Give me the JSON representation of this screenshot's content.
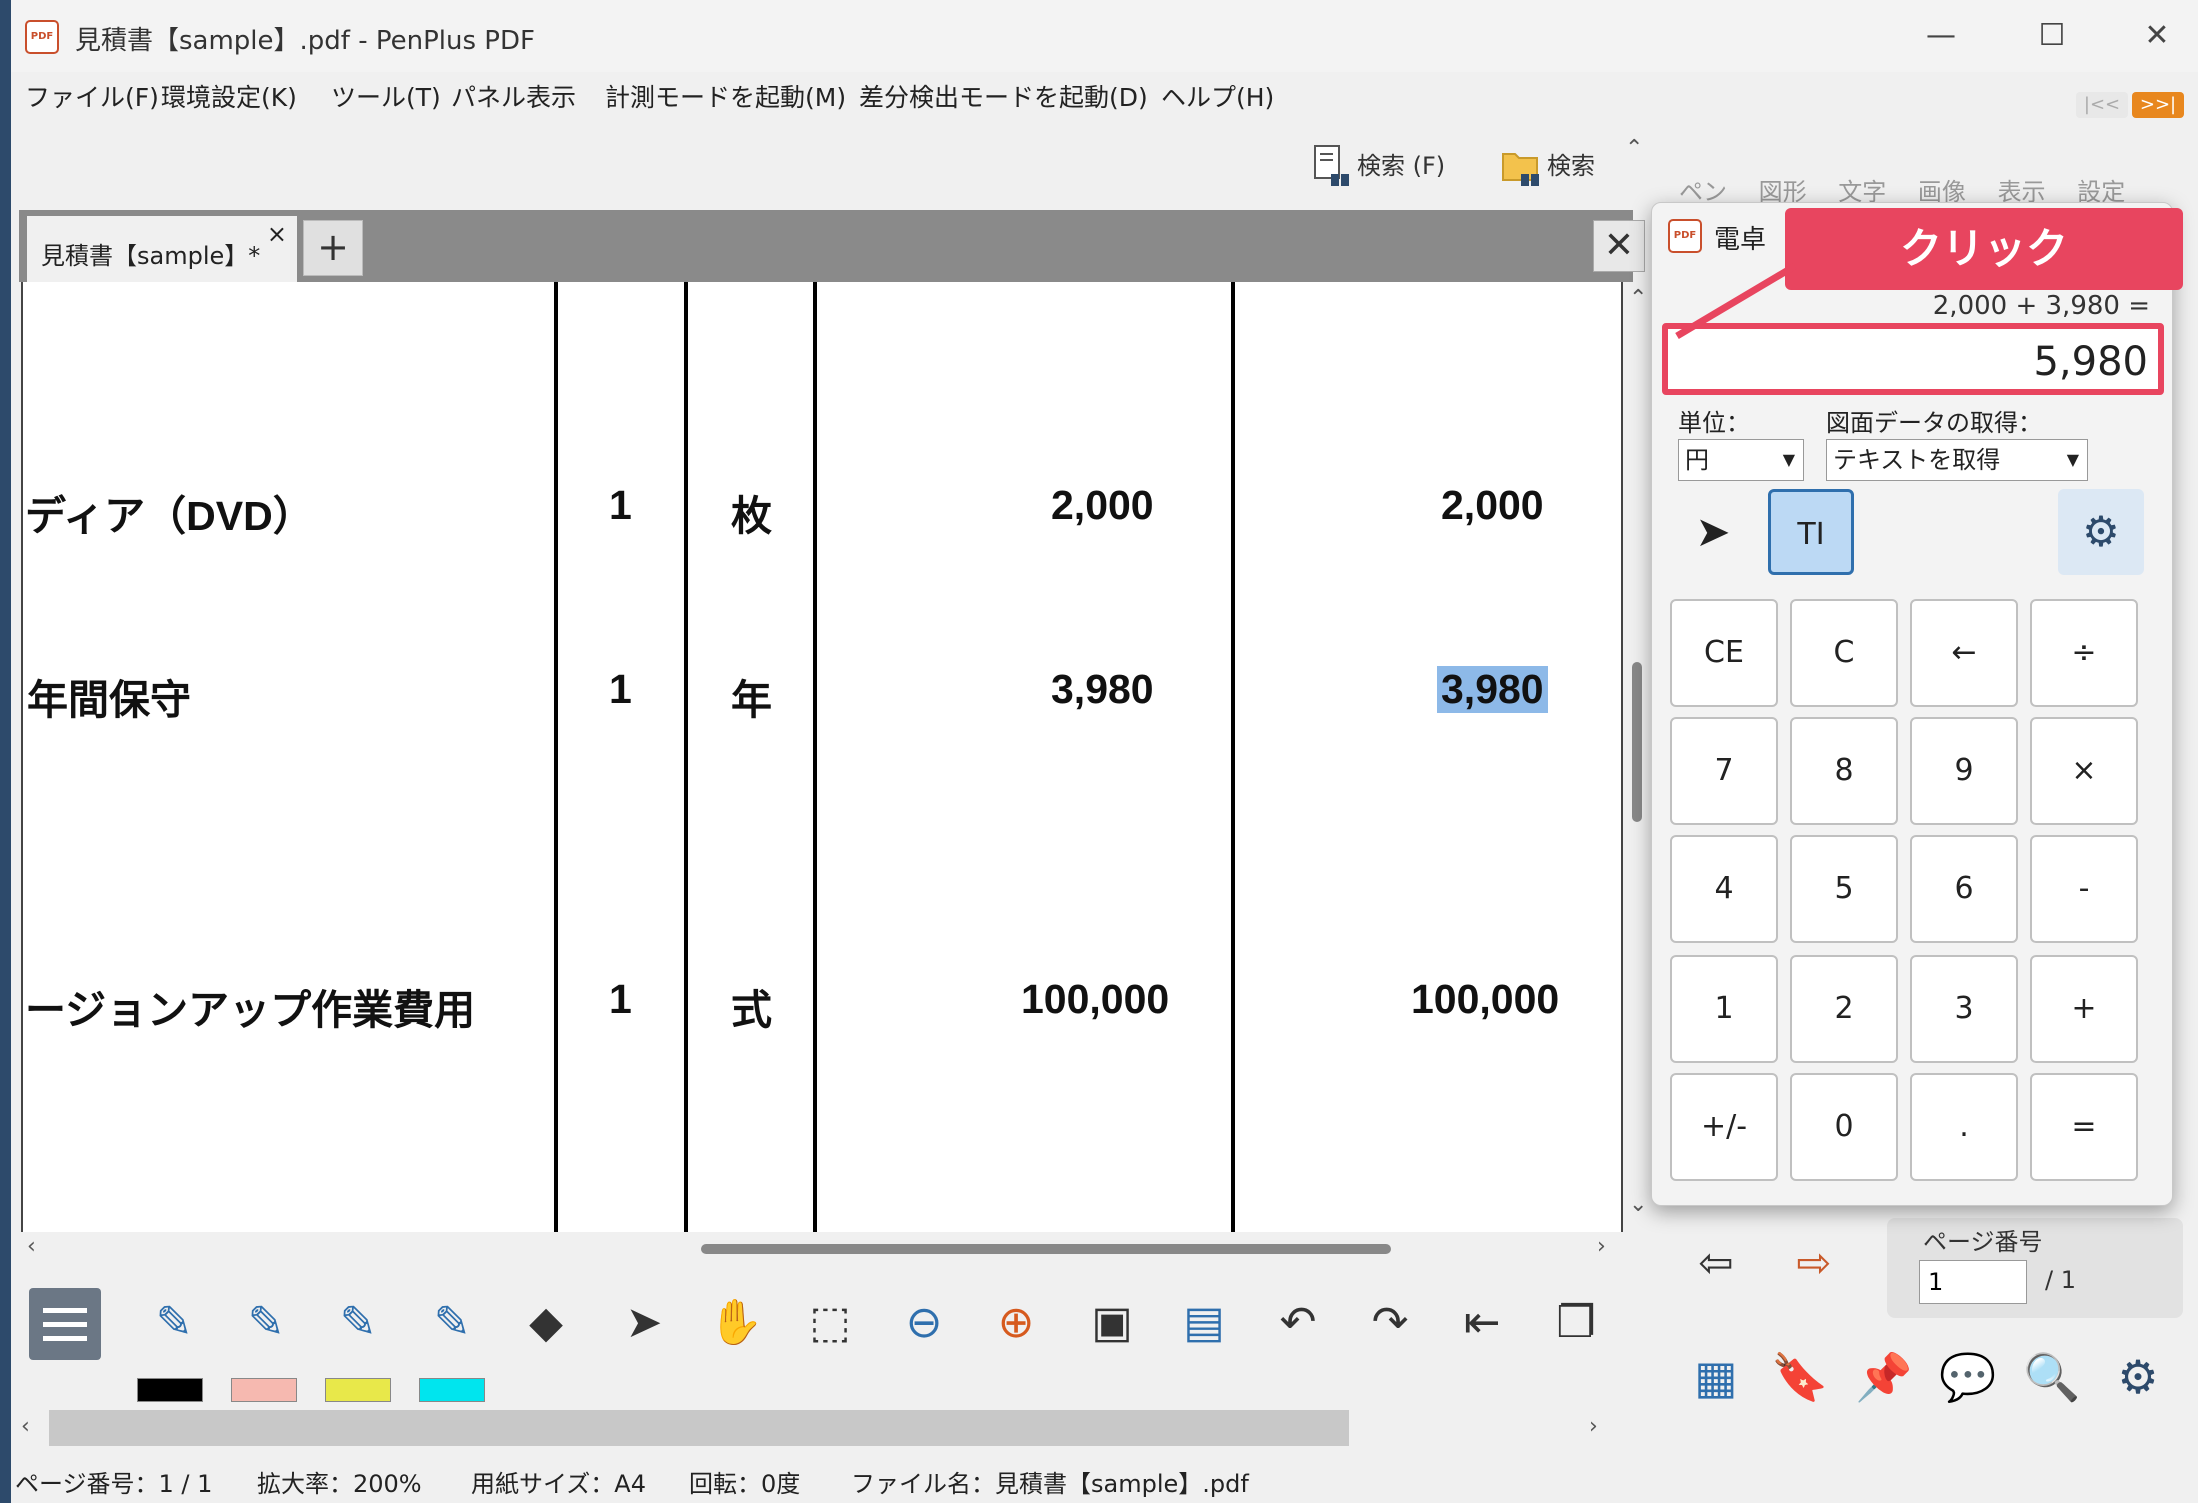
{
  "window": {
    "title": "見積書【sample】.pdf - PenPlus PDF",
    "app_icon_text": "PDF"
  },
  "window_controls": {
    "minimize": "—",
    "maximize": "☐",
    "close": "✕"
  },
  "menu": [
    "ファイル(F)",
    "環境設定(K)",
    "ツール(T)",
    "パネル表示",
    "計測モードを起動(M)",
    "差分検出モードを起動(D)",
    "ヘルプ(H)"
  ],
  "toolbar": {
    "search_page": "検索 (F)",
    "search_folder": "検索"
  },
  "right_tabs": [
    "ペン",
    "図形",
    "文字",
    "画像",
    "表示",
    "設定"
  ],
  "doc_tab": {
    "label": "見積書【sample】*",
    "close": "×",
    "new_tab": "+",
    "close_doc": "✕"
  },
  "table_rows": [
    {
      "item": "ディア（DVD）",
      "qty": "1",
      "unit": "枚",
      "price": "2,000",
      "amount": "2,000"
    },
    {
      "item": "年間保守",
      "qty": "1",
      "unit": "年",
      "price": "3,980",
      "amount": "3,980"
    },
    {
      "item": "ージョンアップ作業費用",
      "qty": "1",
      "unit": "式",
      "price": "100,000",
      "amount": "100,000"
    }
  ],
  "colors": {
    "callout": "#e8455f",
    "highlight": "#8db9e8",
    "accent_orange": "#e8871e",
    "blue_tool": "#2f6fad"
  },
  "swatches": [
    "#000000",
    "#f6b9b0",
    "#e8e84a",
    "#00e5ee"
  ],
  "calculator": {
    "title": "電卓",
    "expression": "2,000 + 3,980 =",
    "display": "5,980",
    "unit_label": "単位：",
    "unit_value": "円",
    "fetch_label": "図面データの取得：",
    "fetch_value": "テキストを取得",
    "keys": [
      "CE",
      "C",
      "←",
      "÷",
      "7",
      "8",
      "9",
      "×",
      "4",
      "5",
      "6",
      "-",
      "1",
      "2",
      "3",
      "+",
      "+/-",
      "0",
      ".",
      "="
    ]
  },
  "annotation": {
    "callout": "クリック"
  },
  "page_nav": {
    "label": "ページ番号",
    "value": "1",
    "total": "/ 1"
  },
  "status": {
    "page": "ページ番号：1 / 1",
    "zoom": "拡大率：200%",
    "paper": "用紙サイズ：A4",
    "rotation": "回転：0度",
    "filename": "ファイル名：見積書【sample】.pdf"
  },
  "icons": [
    "pen-icon",
    "highlighter-icon",
    "eraser-icon",
    "select-arrow-icon",
    "hand-icon",
    "zoom-out-icon",
    "zoom-in-icon",
    "undo-icon",
    "redo-icon",
    "gear-icon",
    "text-cursor-icon"
  ]
}
